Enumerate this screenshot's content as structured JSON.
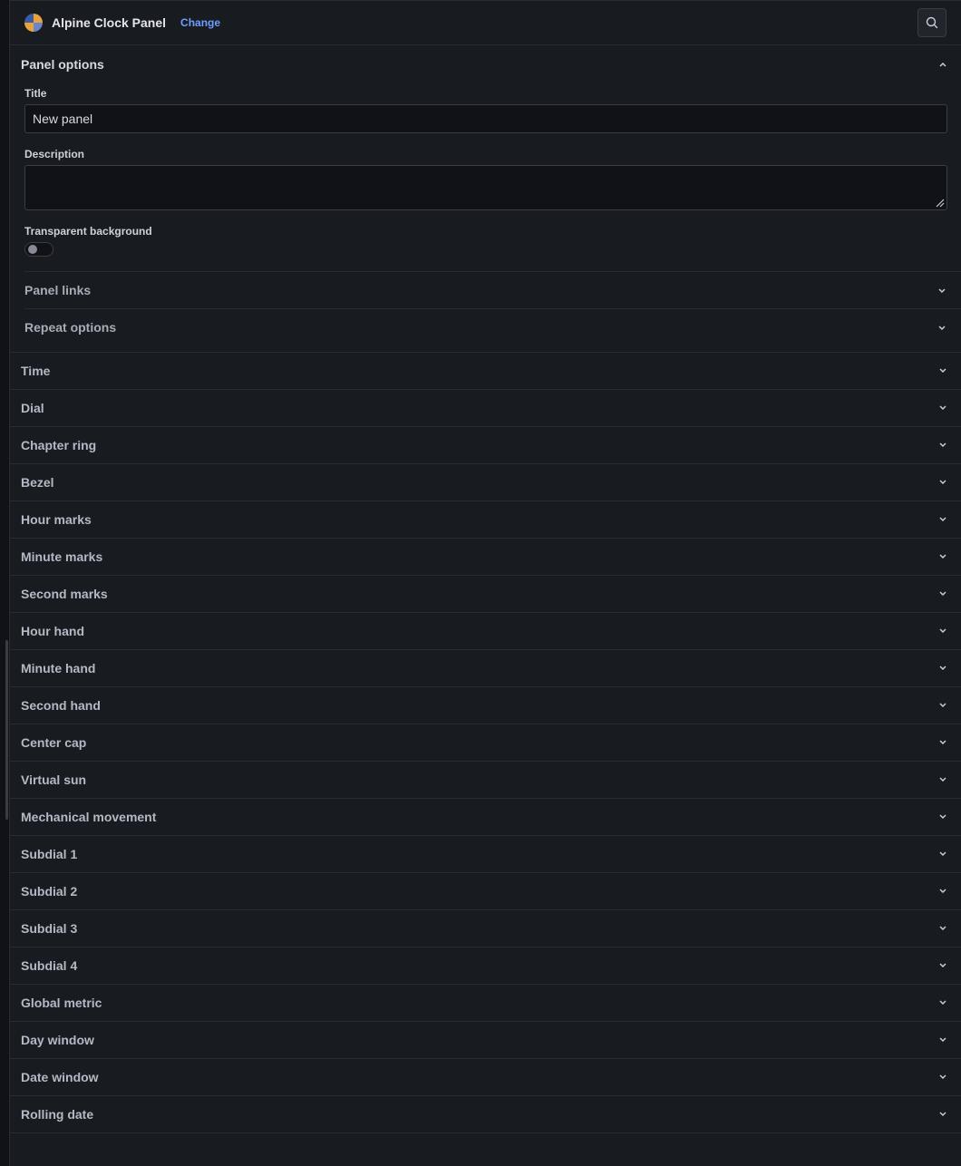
{
  "header": {
    "plugin_name": "Alpine Clock Panel",
    "change_label": "Change"
  },
  "panel_options": {
    "heading": "Panel options",
    "title_label": "Title",
    "title_value": "New panel",
    "description_label": "Description",
    "description_value": "",
    "transparent_label": "Transparent background",
    "transparent_on": false,
    "subsections": [
      "Panel links",
      "Repeat options"
    ]
  },
  "sections": [
    "Time",
    "Dial",
    "Chapter ring",
    "Bezel",
    "Hour marks",
    "Minute marks",
    "Second marks",
    "Hour hand",
    "Minute hand",
    "Second hand",
    "Center cap",
    "Virtual sun",
    "Mechanical movement",
    "Subdial 1",
    "Subdial 2",
    "Subdial 3",
    "Subdial 4",
    "Global metric",
    "Day window",
    "Date window",
    "Rolling date"
  ],
  "colors": {
    "accent": "#6e9fff",
    "background": "#181b1f"
  }
}
